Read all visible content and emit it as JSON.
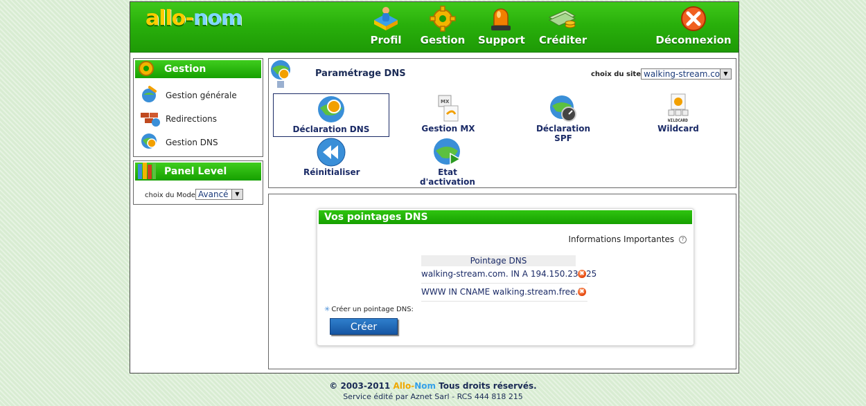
{
  "header": {
    "logo": {
      "part1": "allo",
      "dash": "-",
      "part2": "nom"
    },
    "nav": [
      {
        "label": "Profil",
        "icon": "profile-icon"
      },
      {
        "label": "Gestion",
        "icon": "gear-icon"
      },
      {
        "label": "Support",
        "icon": "alarm-light-icon"
      },
      {
        "label": "Créditer",
        "icon": "money-icon"
      },
      {
        "label": "Déconnexion",
        "icon": "close-icon"
      }
    ]
  },
  "sidebar": {
    "gestion": {
      "title": "Gestion",
      "items": [
        {
          "label": "Gestion générale",
          "icon": "globe-wrench-icon"
        },
        {
          "label": "Redirections",
          "icon": "bricks-icon"
        },
        {
          "label": "Gestion DNS",
          "icon": "globe-dns-icon"
        }
      ]
    },
    "panel_level": {
      "title": "Panel Level",
      "mode_label": "choix du Mode :",
      "mode_value": "Avancé"
    }
  },
  "dns": {
    "title": "Paramétrage DNS",
    "site_label": "choix du site :",
    "site_value": "walking-stream.com",
    "tools": [
      {
        "label": "Déclaration DNS",
        "icon": "globe-dns-icon",
        "selected": true
      },
      {
        "label": "Gestion MX",
        "icon": "mx-mail-icon",
        "selected": false
      },
      {
        "label": "Déclaration SPF",
        "icon": "globe-gauge-icon",
        "selected": false
      },
      {
        "label": "Wildcard",
        "icon": "wildcard-icon",
        "selected": false
      },
      {
        "label": "Réinitialiser",
        "icon": "rewind-icon",
        "selected": false
      },
      {
        "label": "Etat d'activation",
        "icon": "globe-play-icon",
        "selected": false
      }
    ]
  },
  "pointages": {
    "title": "Vos pointages DNS",
    "info_label": "Informations Importantes",
    "info_icon": "?",
    "column_header": "Pointage DNS",
    "rows": [
      "walking-stream.com. IN A 194.150.236.25",
      "WWW IN CNAME walking.stream.free.fr"
    ],
    "delete_glyph": "✖",
    "create_label": "Créer un pointage DNS:",
    "create_star": "✳",
    "create_button": "Créer"
  },
  "footer": {
    "line1_prefix": "© 2003-2011",
    "brand1": "Allo-",
    "brand2": "Nom",
    "line1_suffix": "Tous droits réservés.",
    "line2": "Service édité par Aznet Sarl - RCS 444 818 215"
  },
  "colors": {
    "header_green": "#29b00b",
    "panel_green": "#16a000",
    "button_blue": "#1656a3",
    "text_navy": "#1a2a66"
  }
}
